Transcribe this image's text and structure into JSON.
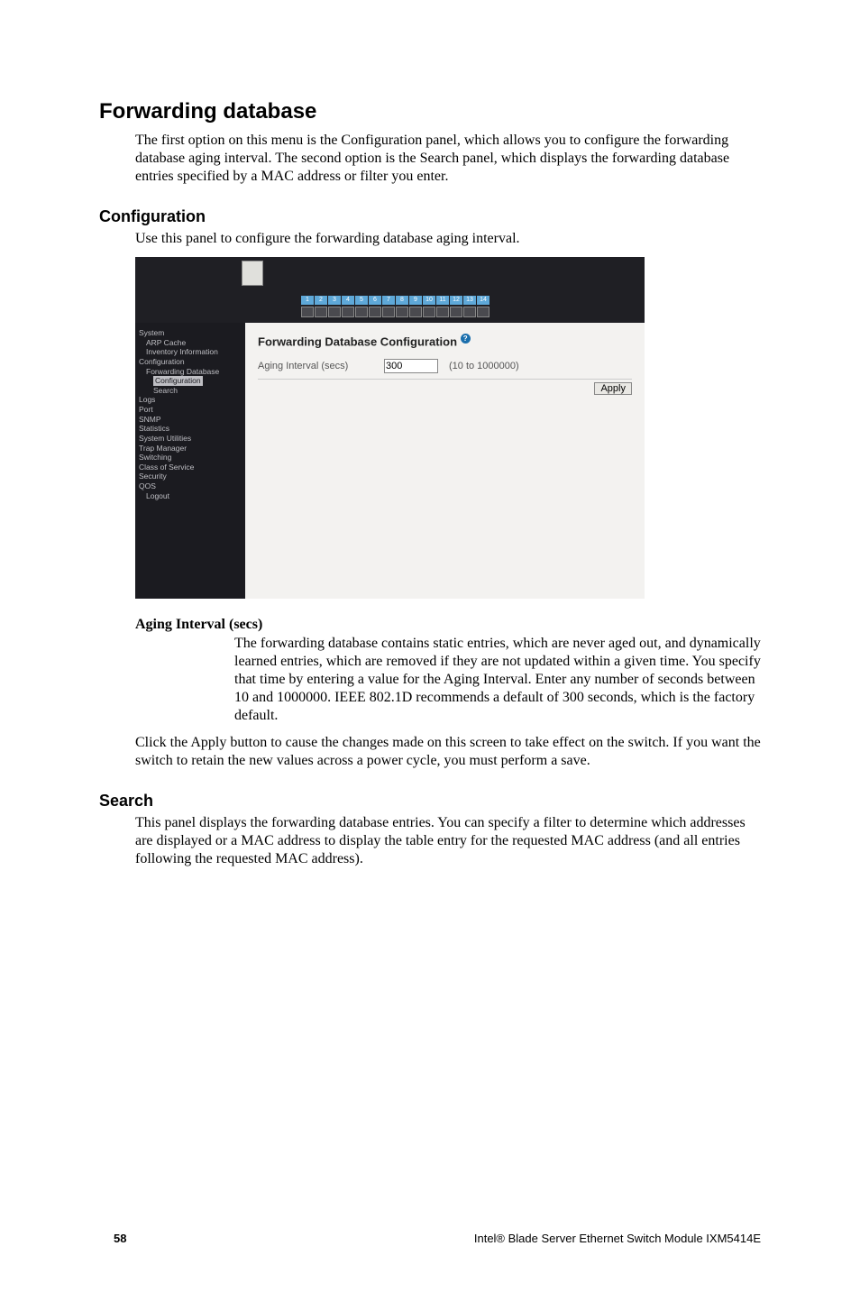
{
  "headings": {
    "h1": "Forwarding database",
    "h2_config": "Configuration",
    "h2_search": "Search"
  },
  "para": {
    "intro": "The first option on this menu is the Configuration panel, which allows you to configure the forwarding database aging interval. The second option is the Search panel, which displays the forwarding database entries specified by a MAC address or filter you enter.",
    "config": "Use this panel to configure the forwarding database aging interval.",
    "aging_term": "Aging Interval (secs)",
    "aging_def": "The forwarding database contains static entries, which are never aged out, and dynamically learned entries, which are removed if they are not updated within a given time. You specify that time by entering a value for the Aging Interval. Enter any number of seconds between 10 and 1000000. IEEE 802.1D recommends a default of 300 seconds, which is the factory default.",
    "apply_note": "Click the Apply button to cause the changes made on this screen to take effect on the switch. If you want the switch to retain the new values across a power cycle, you must perform a save.",
    "search": "This panel displays the forwarding database entries. You can specify a filter to determine which addresses are displayed or a MAC address to display the table entry for the requested MAC address (and all entries following the requested MAC address)."
  },
  "screenshot": {
    "ports": [
      "1",
      "2",
      "3",
      "4",
      "5",
      "6",
      "7",
      "8",
      "9",
      "10",
      "11",
      "12",
      "13",
      "14"
    ],
    "nav": [
      {
        "label": "System",
        "cls": ""
      },
      {
        "label": "ARP Cache",
        "cls": "indent1"
      },
      {
        "label": "Inventory Information",
        "cls": "indent1"
      },
      {
        "label": "Configuration",
        "cls": ""
      },
      {
        "label": "Forwarding Database",
        "cls": "indent1"
      },
      {
        "label": "Configuration",
        "cls": "indent2 sel"
      },
      {
        "label": "Search",
        "cls": "indent2"
      },
      {
        "label": "Logs",
        "cls": ""
      },
      {
        "label": "Port",
        "cls": ""
      },
      {
        "label": "SNMP",
        "cls": ""
      },
      {
        "label": "Statistics",
        "cls": ""
      },
      {
        "label": "System Utilities",
        "cls": ""
      },
      {
        "label": "Trap Manager",
        "cls": ""
      },
      {
        "label": "Switching",
        "cls": ""
      },
      {
        "label": "Class of Service",
        "cls": ""
      },
      {
        "label": "Security",
        "cls": ""
      },
      {
        "label": "QOS",
        "cls": ""
      },
      {
        "label": "Logout",
        "cls": "indent1"
      }
    ],
    "main": {
      "title": "Forwarding Database Configuration",
      "help": "?",
      "field_label": "Aging Interval (secs)",
      "field_value": "300",
      "field_hint": "(10 to 1000000)",
      "apply": "Apply"
    }
  },
  "footer": {
    "page_number": "58",
    "doc_title": "Intel® Blade Server Ethernet Switch Module IXM5414E"
  }
}
